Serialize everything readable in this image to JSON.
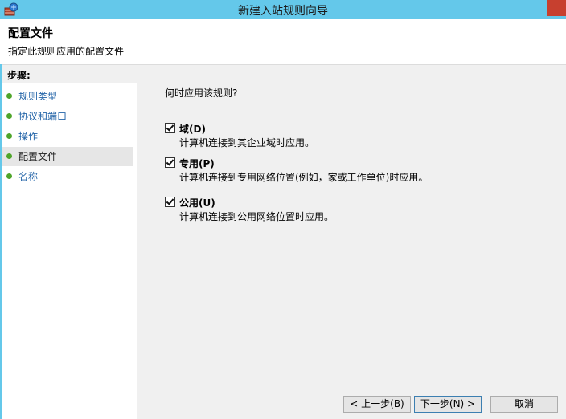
{
  "window": {
    "title": "新建入站规则向导"
  },
  "header": {
    "title": "配置文件",
    "subtitle": "指定此规则应用的配置文件"
  },
  "steps": {
    "heading": "步骤:",
    "items": [
      {
        "label": "规则类型",
        "current": false
      },
      {
        "label": "协议和端口",
        "current": false
      },
      {
        "label": "操作",
        "current": false
      },
      {
        "label": "配置文件",
        "current": true
      },
      {
        "label": "名称",
        "current": false
      }
    ]
  },
  "main": {
    "question": "何时应用该规则?",
    "options": [
      {
        "label": "域(D)",
        "description": "计算机连接到其企业域时应用。",
        "checked": true
      },
      {
        "label": "专用(P)",
        "description": "计算机连接到专用网络位置(例如，家或工作单位)时应用。",
        "checked": true
      },
      {
        "label": "公用(U)",
        "description": "计算机连接到公用网络位置时应用。",
        "checked": true
      }
    ]
  },
  "buttons": {
    "back": "< 上一步(B)",
    "next": "下一步(N) >",
    "cancel": "取消"
  },
  "colors": {
    "titlebar": "#64c8ea",
    "link": "#2465a8",
    "bullet": "#4fa52a",
    "close": "#c7402f"
  }
}
